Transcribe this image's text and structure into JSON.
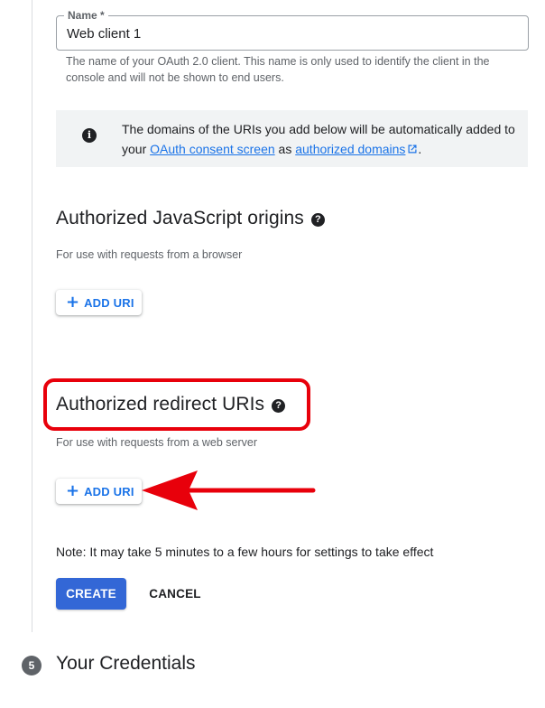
{
  "name_field": {
    "label": "Name *",
    "value": "Web client 1",
    "help": "The name of your OAuth 2.0 client. This name is only used to identify the client in the console and will not be shown to end users."
  },
  "info": {
    "icon": "info-icon",
    "text_before": "The domains of the URIs you add below will be automatically added to your ",
    "link1": "OAuth consent screen",
    "text_middle": " as ",
    "link2": "authorized domains",
    "text_after": "."
  },
  "js_origins": {
    "title": "Authorized JavaScript origins",
    "subtitle": "For use with requests from a browser",
    "add_label": "ADD URI"
  },
  "redirect_uris": {
    "title": "Authorized redirect URIs",
    "subtitle": "For use with requests from a web server",
    "add_label": "ADD URI"
  },
  "annotation": {
    "highlight_color": "#e8000b"
  },
  "note": "Note: It may take 5 minutes to a few hours for settings to take effect",
  "actions": {
    "create": "CREATE",
    "cancel": "CANCEL"
  },
  "next_step": {
    "number": "5",
    "title": "Your Credentials"
  },
  "colors": {
    "accent": "#1a73e8",
    "primary_button": "#3367d6"
  }
}
